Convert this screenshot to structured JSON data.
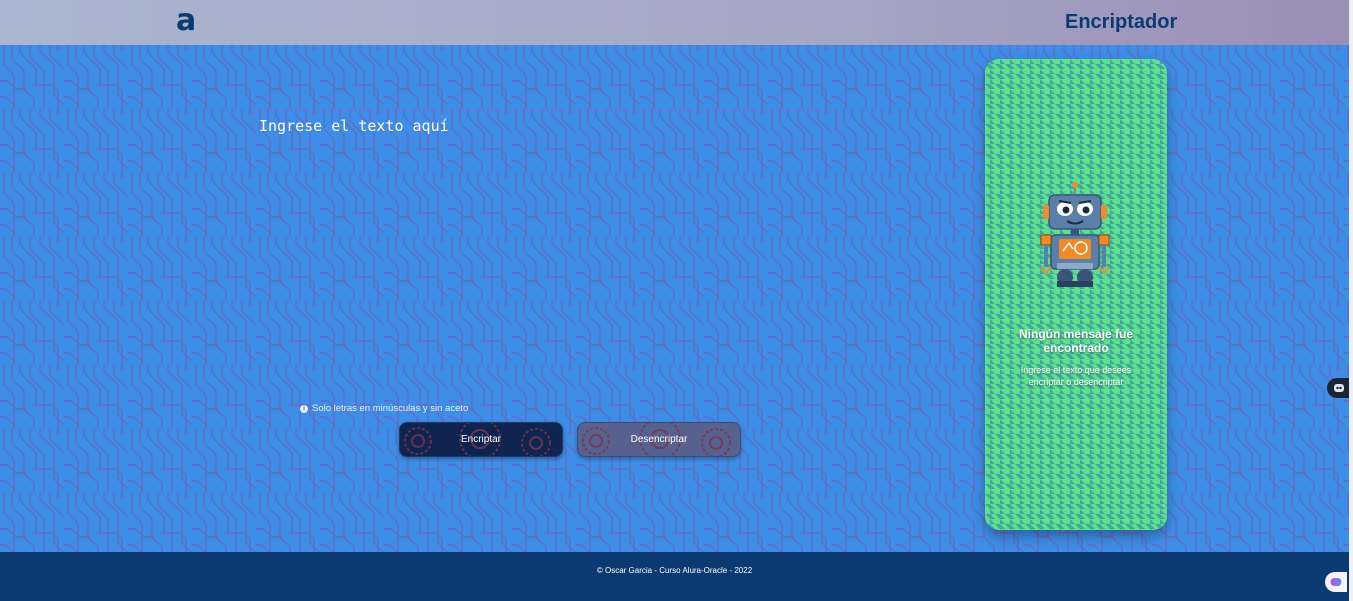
{
  "header": {
    "logo_text": "a",
    "title": "Encriptador"
  },
  "input": {
    "placeholder": "Ingrese el texto aquí"
  },
  "hint": {
    "icon": "info-icon",
    "text": "Solo letras en minúsculas y sin aceto"
  },
  "buttons": {
    "encrypt_label": "Encriptar",
    "decrypt_label": "Desencriptar"
  },
  "result_panel": {
    "title": "Ningún mensaje fue encontrado",
    "text": "Ingrese el texto que desees encriptar o desencriptar"
  },
  "footer": {
    "text": "© Oscar Garcia - Curso Alura-Oracle - 2022"
  },
  "colors": {
    "header_text": "#0b3a73",
    "background": "#3d8ee8",
    "circuit_lines": "#6f5fb7",
    "encrypt_button": "#0f2550",
    "decrypt_button": "#56618e",
    "panel_green": "#5fe08a",
    "footer": "#0b3a73"
  }
}
